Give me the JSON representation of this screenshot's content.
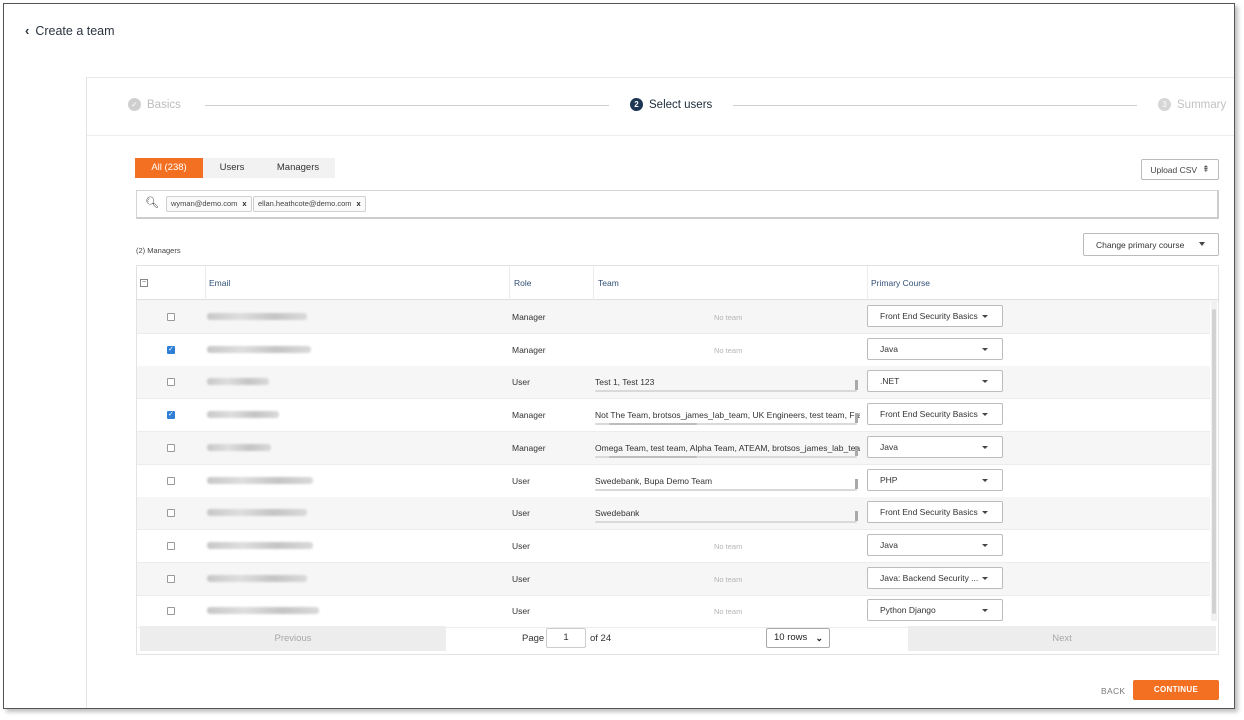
{
  "header": {
    "back_title": "Create a team"
  },
  "stepper": {
    "steps": [
      {
        "label": "Basics",
        "number": "✓"
      },
      {
        "label": "Select users",
        "number": "2"
      },
      {
        "label": "Summary",
        "number": "3"
      }
    ]
  },
  "tabs": {
    "all": "All (238)",
    "users": "Users",
    "managers": "Managers"
  },
  "upload": {
    "label": "Upload CSV",
    "icon": "upload-icon"
  },
  "search": {
    "chips": [
      "wyman@demo.com",
      "ellan.heathcote@demo.com"
    ],
    "remove": "x"
  },
  "count_label": "(2) Managers",
  "change_course": {
    "label": "Change primary course"
  },
  "table": {
    "headers": {
      "email": "Email",
      "role": "Role",
      "team": "Team",
      "course": "Primary Course"
    },
    "rows": [
      {
        "checked": false,
        "role": "Manager",
        "team": "No team",
        "course": "Front End Security Basics"
      },
      {
        "checked": true,
        "role": "Manager",
        "team": "No team",
        "course": "Java"
      },
      {
        "checked": false,
        "role": "User",
        "team": "Test 1, Test 123",
        "course": ".NET"
      },
      {
        "checked": true,
        "role": "Manager",
        "team": "Not The Team, brotsos_james_lab_team, UK Engineers, test team, Fragalie",
        "course": "Front End Security Basics"
      },
      {
        "checked": false,
        "role": "Manager",
        "team": "Omega Team, test team, Alpha Team, ATEAM, brotsos_james_lab_team, Fr",
        "course": "Java"
      },
      {
        "checked": false,
        "role": "User",
        "team": "Swedebank, Bupa Demo Team",
        "course": "PHP"
      },
      {
        "checked": false,
        "role": "User",
        "team": "Swedebank",
        "course": "Front End Security Basics"
      },
      {
        "checked": false,
        "role": "User",
        "team": "No team",
        "course": "Java"
      },
      {
        "checked": false,
        "role": "User",
        "team": "No team",
        "course": "Java: Backend Security ..."
      },
      {
        "checked": false,
        "role": "User",
        "team": "No team",
        "course": "Python Django"
      }
    ]
  },
  "pager": {
    "previous": "Previous",
    "page_label": "Page",
    "page_value": "1",
    "of_label": "of 24",
    "rows_label": "10 rows",
    "next": "Next"
  },
  "footer": {
    "back": "BACK",
    "continue": "CONTINUE"
  },
  "colors": {
    "accent": "#f36f21",
    "navy": "#1c3553",
    "checkbox": "#2f7fd6"
  }
}
